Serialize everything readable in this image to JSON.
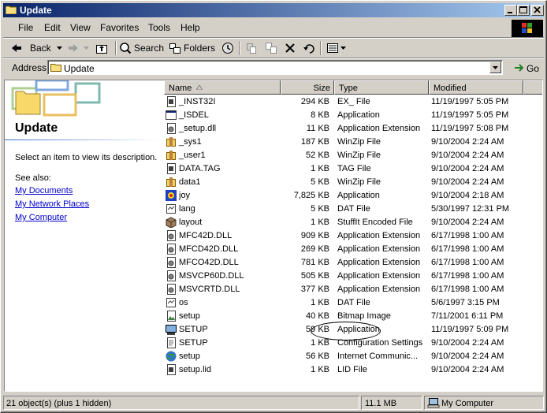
{
  "window": {
    "title": "Update"
  },
  "menu": [
    "File",
    "Edit",
    "View",
    "Favorites",
    "Tools",
    "Help"
  ],
  "toolbar": {
    "back": "Back",
    "search": "Search",
    "folders": "Folders"
  },
  "address": {
    "label": "Address",
    "value": "Update",
    "go": "Go"
  },
  "left_panel": {
    "title": "Update",
    "description": "Select an item to view its description.",
    "see_also": "See also:",
    "links": [
      "My Documents",
      "My Network Places",
      "My Computer"
    ]
  },
  "columns": {
    "name": "Name",
    "size": "Size",
    "type": "Type",
    "modified": "Modified"
  },
  "files": [
    {
      "name": "_INST32I",
      "size": "294 KB",
      "type": "EX_ File",
      "modified": "11/19/1997 5:05 PM",
      "icon": "generic-file-icon"
    },
    {
      "name": "_ISDEL",
      "size": "8 KB",
      "type": "Application",
      "modified": "11/19/1997 5:05 PM",
      "icon": "application-icon"
    },
    {
      "name": "_setup.dll",
      "size": "11 KB",
      "type": "Application Extension",
      "modified": "11/19/1997 5:08 PM",
      "icon": "dll-icon"
    },
    {
      "name": "_sys1",
      "size": "187 KB",
      "type": "WinZip File",
      "modified": "9/10/2004 2:24 AM",
      "icon": "winzip-icon"
    },
    {
      "name": "_user1",
      "size": "52 KB",
      "type": "WinZip File",
      "modified": "9/10/2004 2:24 AM",
      "icon": "winzip-icon"
    },
    {
      "name": "DATA.TAG",
      "size": "1 KB",
      "type": "TAG File",
      "modified": "9/10/2004 2:24 AM",
      "icon": "generic-file-icon"
    },
    {
      "name": "data1",
      "size": "5 KB",
      "type": "WinZip File",
      "modified": "9/10/2004 2:24 AM",
      "icon": "winzip-icon"
    },
    {
      "name": "joy",
      "size": "7,825 KB",
      "type": "Application",
      "modified": "9/10/2004 2:18 AM",
      "icon": "joy-app-icon"
    },
    {
      "name": "lang",
      "size": "5 KB",
      "type": "DAT File",
      "modified": "5/30/1997 12:31 PM",
      "icon": "dat-file-icon"
    },
    {
      "name": "layout",
      "size": "1 KB",
      "type": "StuffIt Encoded File",
      "modified": "9/10/2004 2:24 AM",
      "icon": "stuffit-icon"
    },
    {
      "name": "MFC42D.DLL",
      "size": "909 KB",
      "type": "Application Extension",
      "modified": "6/17/1998 1:00 AM",
      "icon": "dll-icon"
    },
    {
      "name": "MFCD42D.DLL",
      "size": "269 KB",
      "type": "Application Extension",
      "modified": "6/17/1998 1:00 AM",
      "icon": "dll-icon"
    },
    {
      "name": "MFCO42D.DLL",
      "size": "781 KB",
      "type": "Application Extension",
      "modified": "6/17/1998 1:00 AM",
      "icon": "dll-icon"
    },
    {
      "name": "MSVCP60D.DLL",
      "size": "505 KB",
      "type": "Application Extension",
      "modified": "6/17/1998 1:00 AM",
      "icon": "dll-icon"
    },
    {
      "name": "MSVCRTD.DLL",
      "size": "377 KB",
      "type": "Application Extension",
      "modified": "6/17/1998 1:00 AM",
      "icon": "dll-icon"
    },
    {
      "name": "os",
      "size": "1 KB",
      "type": "DAT File",
      "modified": "5/6/1997 3:15 PM",
      "icon": "dat-file-icon"
    },
    {
      "name": "setup",
      "size": "40 KB",
      "type": "Bitmap Image",
      "modified": "7/11/2001 6:11 PM",
      "icon": "bitmap-icon"
    },
    {
      "name": "SETUP",
      "size": "59 KB",
      "type": "Application",
      "modified": "11/19/1997 5:09 PM",
      "icon": "setup-app-icon"
    },
    {
      "name": "SETUP",
      "size": "1 KB",
      "type": "Configuration Settings",
      "modified": "9/10/2004 2:24 AM",
      "icon": "config-file-icon"
    },
    {
      "name": "setup",
      "size": "56 KB",
      "type": "Internet Communic...",
      "modified": "9/10/2004 2:24 AM",
      "icon": "internet-file-icon"
    },
    {
      "name": "setup.lid",
      "size": "1 KB",
      "type": "LID File",
      "modified": "9/10/2004 2:24 AM",
      "icon": "generic-file-icon"
    }
  ],
  "status": {
    "objects": "21 object(s) (plus 1 hidden)",
    "size": "11.1 MB",
    "zone": "My Computer"
  },
  "colors": {
    "titlebar_start": "#0a246a",
    "titlebar_end": "#a6caf0",
    "face": "#d4d0c8",
    "link": "#0000cc"
  }
}
